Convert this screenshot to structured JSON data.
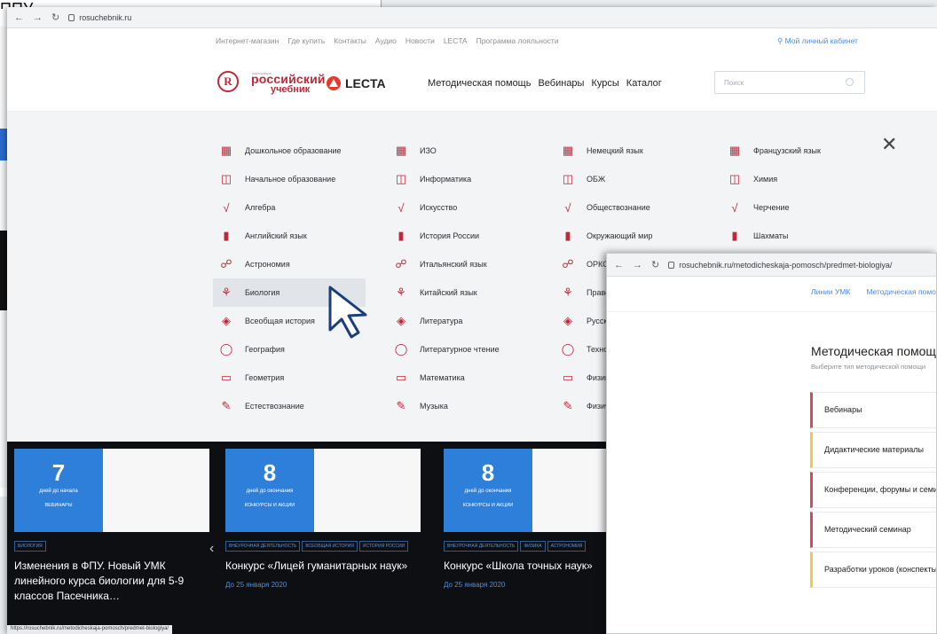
{
  "background_window": {
    "top_text": "ППУ"
  },
  "main_window": {
    "url": "rosuchebnik.ru",
    "topbar": {
      "links": [
        "Интернет-магазин",
        "Где купить",
        "Контакты",
        "Аудио",
        "Новости",
        "LECTA",
        "Программа лояльности"
      ],
      "account": "Мой личный кабинет"
    },
    "header": {
      "logo_small": "корпорация",
      "logo_line1": "российский",
      "logo_line2": "учебник",
      "lecta": "LECTA",
      "nav": [
        "Методическая помощь",
        "Вебинары",
        "Курсы",
        "Каталог"
      ],
      "search_placeholder": "Поиск"
    },
    "subjects": {
      "col1": [
        "Дошкольное образование",
        "Начальное образование",
        "Алгебра",
        "Английский язык",
        "Астрономия",
        "Биология",
        "Всеобщая история",
        "География",
        "Геометрия",
        "Естествознание"
      ],
      "col2": [
        "ИЗО",
        "Информатика",
        "Искусство",
        "История России",
        "Итальянский язык",
        "Китайский язык",
        "Литература",
        "Литературное чтение",
        "Математика",
        "Музыка"
      ],
      "col3": [
        "Немецкий язык",
        "ОБЖ",
        "Обществознание",
        "Окружающий мир",
        "ОРКСЭ",
        "Право",
        "Русский язык",
        "Технология",
        "Физика",
        "Физическая культура"
      ],
      "col4": [
        "Французский язык",
        "Химия",
        "Черчение",
        "Шахматы"
      ],
      "highlighted": "Биология"
    },
    "cards": [
      {
        "badge_number": "7",
        "badge_text": "дней до начала",
        "badge_cat": "ВЕБИНАРЫ",
        "tags": [
          "БИОЛОГИЯ"
        ],
        "title": "Изменения в ФПУ. Новый УМК линейного курса биологии для 5-9 классов Пасечника…",
        "date": ""
      },
      {
        "badge_number": "8",
        "badge_text": "дней до окончания",
        "badge_cat": "КОНКУРСЫ И АКЦИИ",
        "tags": [
          "ВНЕУРОЧНАЯ ДЕЯТЕЛЬНОСТЬ",
          "ВСЕОБЩАЯ ИСТОРИЯ",
          "ИСТОРИЯ РОССИИ"
        ],
        "title": "Конкурс «Лицей гуманитарных наук»",
        "date": "До 25 января 2020"
      },
      {
        "badge_number": "8",
        "badge_text": "дней до окончания",
        "badge_cat": "КОНКУРСЫ И АКЦИИ",
        "tags": [
          "ВНЕУРОЧНАЯ ДЕЯТЕЛЬНОСТЬ",
          "ФИЗИКА",
          "АСТРОНОМИЯ"
        ],
        "title": "Конкурс «Школа точных наук»",
        "date": "До 25 января 2020"
      }
    ],
    "status_url": "https://rosuchebnik.ru/metodicheskaja-pomosch/predmet-biologiya/"
  },
  "overlay_window": {
    "url": "rosuchebnik.ru/metodicheskaja-pomosch/predmet-biologiya/",
    "nav": [
      "Линии УМК",
      "Методическая помощь"
    ],
    "title": "Методическая помощь",
    "subtitle": "Выберите тип методической помощи",
    "items": [
      "Вебинары",
      "Дидактические материалы",
      "Конференции, форумы и семинары",
      "Методический семинар",
      "Разработки уроков (конспекты)"
    ],
    "item_colors": [
      "#e04552",
      "#f2c94c",
      "#e04552",
      "#e04552",
      "#f2c94c"
    ]
  }
}
